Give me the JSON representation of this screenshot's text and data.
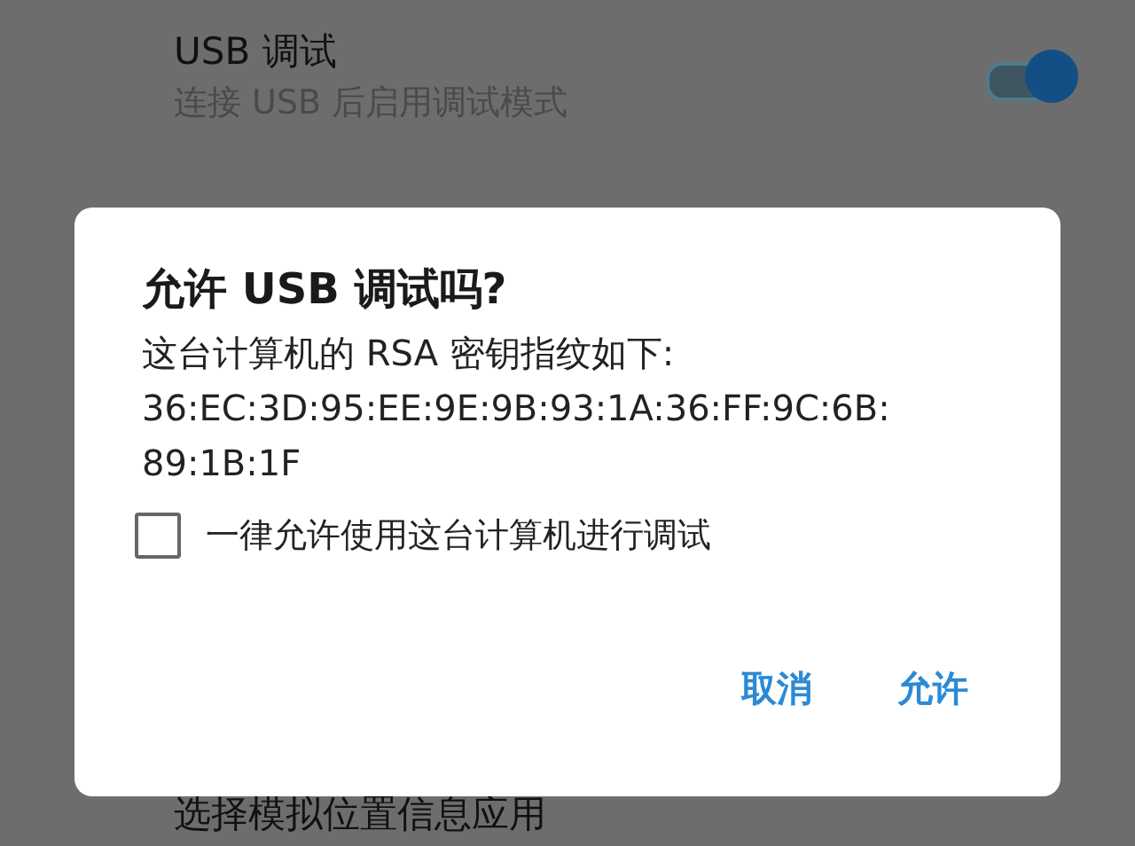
{
  "settings": [
    {
      "title": "USB 调试",
      "subtitle": "连接 USB 后启用调试模式",
      "switch_on": true
    },
    {
      "title": "选择模拟位置信息应用"
    }
  ],
  "dialog": {
    "title": "允许 USB 调试吗?",
    "message": "这台计算机的 RSA 密钥指纹如下:",
    "fingerprint": "36:EC:3D:95:EE:9E:9B:93:1A:36:FF:9C:6B:\n89:1B:1F",
    "checkbox": {
      "label": "一律允许使用这台计算机进行调试",
      "checked": false
    },
    "buttons": [
      "取消",
      "允许"
    ]
  }
}
